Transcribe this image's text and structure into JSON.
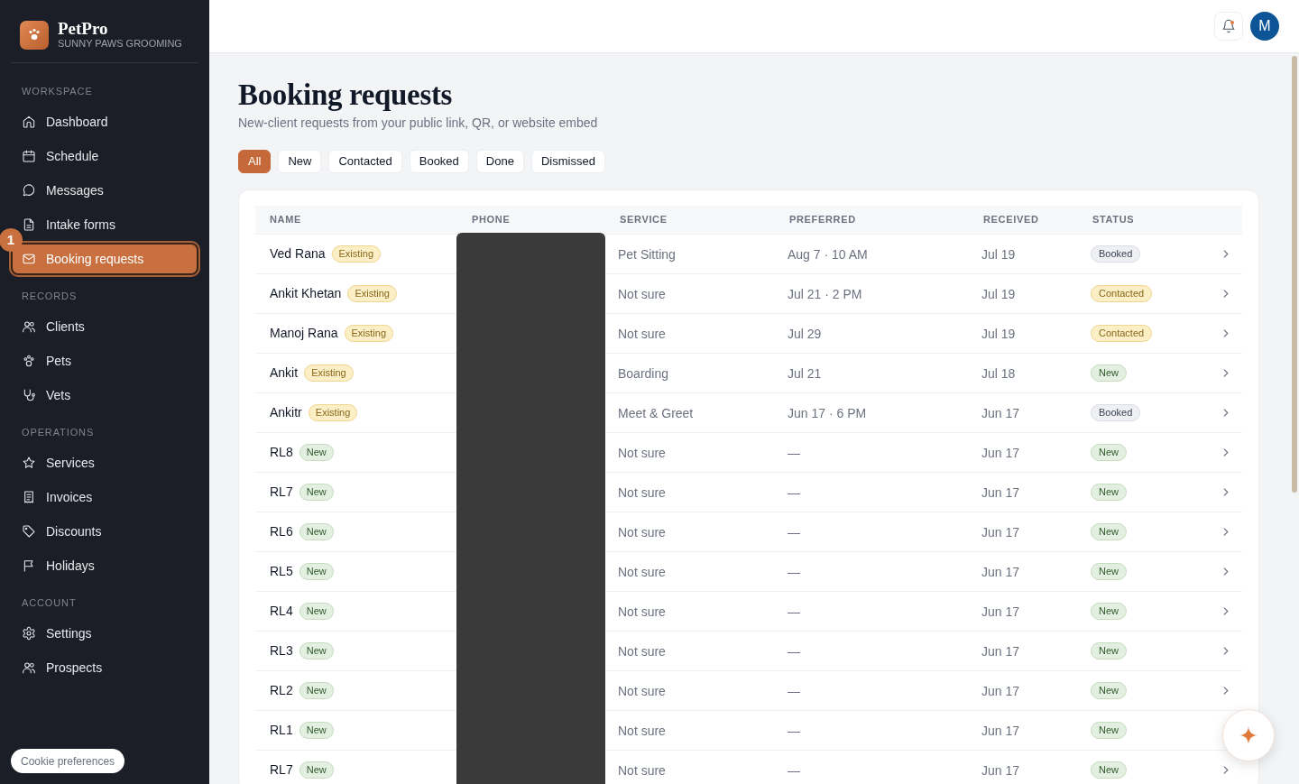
{
  "sidebar": {
    "brand": {
      "name": "PetPro",
      "subtitle": "SUNNY PAWS GROOMING"
    },
    "sections": [
      {
        "label": "WORKSPACE",
        "items": [
          {
            "label": "Dashboard",
            "selected": false
          },
          {
            "label": "Schedule",
            "selected": false
          },
          {
            "label": "Messages",
            "selected": false
          },
          {
            "label": "Intake forms",
            "selected": false
          },
          {
            "label": "Booking requests",
            "selected": true
          }
        ]
      },
      {
        "label": "RECORDS",
        "items": [
          {
            "label": "Clients",
            "selected": false
          },
          {
            "label": "Pets",
            "selected": false
          },
          {
            "label": "Vets",
            "selected": false
          }
        ]
      },
      {
        "label": "OPERATIONS",
        "items": [
          {
            "label": "Services",
            "selected": false
          },
          {
            "label": "Invoices",
            "selected": false
          },
          {
            "label": "Discounts",
            "selected": false
          },
          {
            "label": "Holidays",
            "selected": false
          }
        ]
      },
      {
        "label": "ACCOUNT",
        "items": [
          {
            "label": "Settings",
            "selected": false
          },
          {
            "label": "Prospects",
            "selected": false
          }
        ]
      }
    ],
    "callout": "1",
    "cookie_button": "Cookie preferences"
  },
  "topbar": {
    "notifications": {
      "unread": true
    },
    "avatar": "M"
  },
  "header": {
    "title": "Booking requests",
    "subtitle": "New-client requests from your public link, QR, or website embed"
  },
  "filters": [
    {
      "label": "All",
      "selected": true
    },
    {
      "label": "New",
      "selected": false
    },
    {
      "label": "Contacted",
      "selected": false
    },
    {
      "label": "Booked",
      "selected": false
    },
    {
      "label": "Done",
      "selected": false
    },
    {
      "label": "Dismissed",
      "selected": false
    }
  ],
  "table": {
    "columns": [
      "NAME",
      "PHONE",
      "SERVICE",
      "PREFERRED",
      "RECEIVED",
      "STATUS"
    ],
    "phone_redacted": true,
    "rows": [
      {
        "name": "Ved Rana",
        "tag": {
          "label": "Existing",
          "kind": "existing"
        },
        "service": "Pet Sitting",
        "preferred": "Aug 7 · 10 AM",
        "received": "Jul 19",
        "status": {
          "label": "Booked",
          "kind": "booked"
        }
      },
      {
        "name": "Ankit Khetan",
        "tag": {
          "label": "Existing",
          "kind": "existing"
        },
        "service": "Not sure",
        "preferred": "Jul 21 · 2 PM",
        "received": "Jul 19",
        "status": {
          "label": "Contacted",
          "kind": "contacted"
        }
      },
      {
        "name": "Manoj Rana",
        "tag": {
          "label": "Existing",
          "kind": "existing"
        },
        "service": "Not sure",
        "preferred": "Jul 29",
        "received": "Jul 19",
        "status": {
          "label": "Contacted",
          "kind": "contacted"
        }
      },
      {
        "name": "Ankit",
        "tag": {
          "label": "Existing",
          "kind": "existing"
        },
        "service": "Boarding",
        "preferred": "Jul 21",
        "received": "Jul 18",
        "status": {
          "label": "New",
          "kind": "new"
        }
      },
      {
        "name": "Ankitr",
        "tag": {
          "label": "Existing",
          "kind": "existing"
        },
        "service": "Meet & Greet",
        "preferred": "Jun 17 · 6 PM",
        "received": "Jun 17",
        "status": {
          "label": "Booked",
          "kind": "booked"
        }
      },
      {
        "name": "RL8",
        "tag": {
          "label": "New",
          "kind": "new"
        },
        "service": "Not sure",
        "preferred": "—",
        "received": "Jun 17",
        "status": {
          "label": "New",
          "kind": "new"
        }
      },
      {
        "name": "RL7",
        "tag": {
          "label": "New",
          "kind": "new"
        },
        "service": "Not sure",
        "preferred": "—",
        "received": "Jun 17",
        "status": {
          "label": "New",
          "kind": "new"
        }
      },
      {
        "name": "RL6",
        "tag": {
          "label": "New",
          "kind": "new"
        },
        "service": "Not sure",
        "preferred": "—",
        "received": "Jun 17",
        "status": {
          "label": "New",
          "kind": "new"
        }
      },
      {
        "name": "RL5",
        "tag": {
          "label": "New",
          "kind": "new"
        },
        "service": "Not sure",
        "preferred": "—",
        "received": "Jun 17",
        "status": {
          "label": "New",
          "kind": "new"
        }
      },
      {
        "name": "RL4",
        "tag": {
          "label": "New",
          "kind": "new"
        },
        "service": "Not sure",
        "preferred": "—",
        "received": "Jun 17",
        "status": {
          "label": "New",
          "kind": "new"
        }
      },
      {
        "name": "RL3",
        "tag": {
          "label": "New",
          "kind": "new"
        },
        "service": "Not sure",
        "preferred": "—",
        "received": "Jun 17",
        "status": {
          "label": "New",
          "kind": "new"
        }
      },
      {
        "name": "RL2",
        "tag": {
          "label": "New",
          "kind": "new"
        },
        "service": "Not sure",
        "preferred": "—",
        "received": "Jun 17",
        "status": {
          "label": "New",
          "kind": "new"
        }
      },
      {
        "name": "RL1",
        "tag": {
          "label": "New",
          "kind": "new"
        },
        "service": "Not sure",
        "preferred": "—",
        "received": "Jun 17",
        "status": {
          "label": "New",
          "kind": "new"
        }
      },
      {
        "name": "RL7",
        "tag": {
          "label": "New",
          "kind": "new"
        },
        "service": "Not sure",
        "preferred": "—",
        "received": "Jun 17",
        "status": {
          "label": "New",
          "kind": "new"
        }
      }
    ]
  }
}
